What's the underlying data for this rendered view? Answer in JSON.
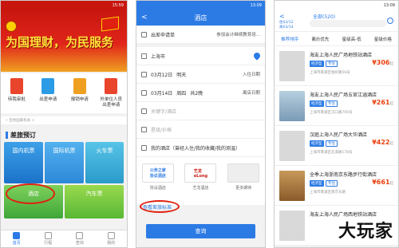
{
  "phone1": {
    "status_time": "15:59",
    "banner_headline": "为国理财，为民服务",
    "quick_items": [
      {
        "label": "待我审批",
        "color": "#e8452c"
      },
      {
        "label": "出差申请",
        "color": "#2c9be5"
      },
      {
        "label": "报销申请",
        "color": "#f0a020"
      },
      {
        "label": "外单位人员\n出差申请",
        "color": "#e8452c"
      }
    ],
    "notice": "• 宝地国家机关 >",
    "section_title": "差旅预订",
    "tiles": [
      {
        "label": "国内机票"
      },
      {
        "label": "国际机票"
      },
      {
        "label": "火车票"
      },
      {
        "label": "酒店"
      },
      {
        "label": "汽车票"
      }
    ],
    "tabs": [
      "首页",
      "行程",
      "查询",
      "我的"
    ]
  },
  "phone2": {
    "status_time": "13:09",
    "title": "酒店",
    "back": "<",
    "rows": {
      "apply_label": "出差申请单",
      "apply_value": "参加会计继续教育培...",
      "city": "上海市",
      "checkin_date": "03月12日",
      "checkin_day": "明天",
      "checkin_label": "入住日期",
      "checkout_date": "03月14日",
      "checkout_day": "周四",
      "nights": "共2晚",
      "checkout_label": "离店日期",
      "keyword_placeholder": "关键字/酒店",
      "star_placeholder": "星级/价格",
      "mine": "我的酒店（曾经入住/我的收藏/我的测温）"
    },
    "brands": [
      {
        "logo": "公务之家\n协议酒店",
        "label": "协议酒店"
      },
      {
        "logo": "艺龙\neLong",
        "label": "艺龙酒店"
      },
      {
        "logo": "",
        "label": "更多期待"
      }
    ],
    "standard_link": "查看差旅标准",
    "search_button": "查询"
  },
  "phone3": {
    "status_time": "13:09",
    "city": "全部(520)",
    "dates": "住03/12\n离03/14",
    "filters": [
      "推荐排序",
      "离价优先",
      "星级高-低",
      "星级价格"
    ],
    "hotels": [
      {
        "name": "海友上海人民广场地铁站酒店",
        "badge": "经济型",
        "star": "专住",
        "price": "306",
        "addr": "上海市黄浦区牯岭路56号",
        "noimg": true
      },
      {
        "name": "海友上海人民广场五官江涵酒店",
        "badge": "经济型",
        "star": "专住",
        "price": "261",
        "addr": "上海市黄浦区汉口路700号",
        "noimg": false
      },
      {
        "name": "汉庭上海人民广场大华酒店",
        "badge": "经济型",
        "star": "专住",
        "price": "422",
        "addr": "上海市黄浦区北海路178号",
        "noimg": true
      },
      {
        "name": "全季上海浙南京东路步行街酒店",
        "badge": "经济型",
        "star": "专住",
        "price": "661",
        "addr": "上海市黄浦区南京东路",
        "noimg": false
      },
      {
        "name": "海友上海人民广场西地铁站酒店",
        "badge": "经济型",
        "star": "专住",
        "price": "",
        "addr": "",
        "noimg": true
      }
    ],
    "watermark": "大玩家"
  },
  "colors": {
    "brand_blue": "#2c7be5",
    "gov_red": "#c8160f",
    "price_orange": "#e8400f",
    "highlight_red": "#e02010"
  }
}
